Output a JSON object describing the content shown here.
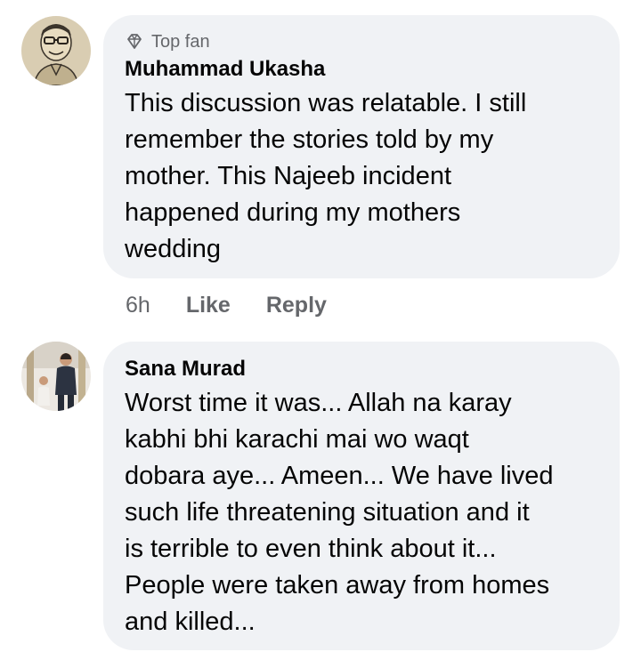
{
  "comments": [
    {
      "badge": "Top fan",
      "author": "Muhammad Ukasha",
      "lines": [
        "This discussion was relatable. I still",
        "remember the stories told by my",
        "mother. This Najeeb incident",
        "happened during my mothers",
        "wedding"
      ],
      "time": "6h",
      "like": "Like",
      "reply": "Reply"
    },
    {
      "author": "Sana Murad",
      "lines": [
        "Worst time it was... Allah na karay",
        "kabhi bhi karachi mai wo waqt",
        "dobara aye... Ameen... We have lived",
        "such life threatening situation and it",
        "is terrible to even think about it...",
        "People were taken away from homes",
        "and killed..."
      ]
    }
  ],
  "colors": {
    "bubble": "#f0f2f5",
    "secondary_text": "#65676b",
    "primary_text": "#050505"
  },
  "icons": {
    "badge": "diamond-icon"
  }
}
